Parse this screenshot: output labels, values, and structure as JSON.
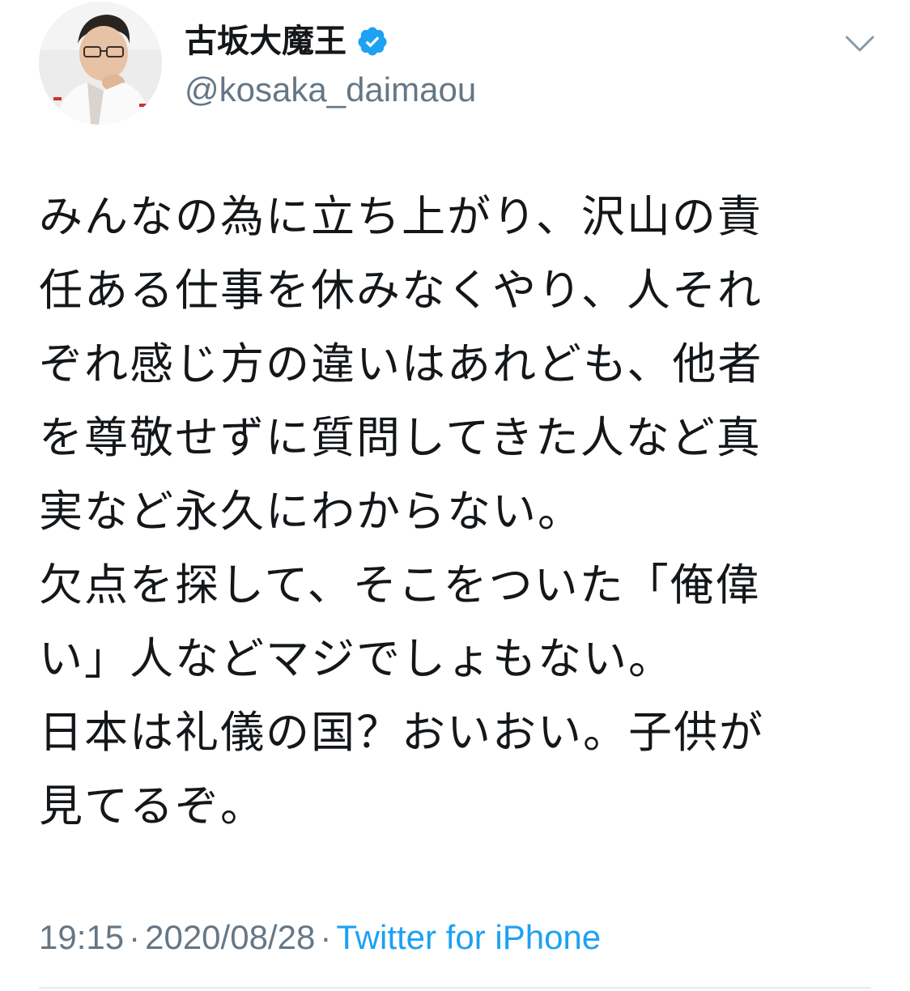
{
  "author": {
    "display_name": "古坂大魔王",
    "handle": "@kosaka_daimaou",
    "verified_icon": "verified-badge-icon",
    "avatar_icon": "profile-photo"
  },
  "menu_icon": "chevron-down-icon",
  "tweet": {
    "lines": [
      "みんなの為に立ち上がり、沢山の責",
      "任ある仕事を休みなくやり、人それ",
      "ぞれ感じ方の違いはあれども、他者",
      "を尊敬せずに質問してきた人など真",
      "実など永久にわからない。",
      "欠点を探して、そこをついた「俺偉",
      "い」人などマジでしょもない。",
      "日本は礼儀の国？おいおい。子供が",
      "見てるぞ。"
    ]
  },
  "meta": {
    "time": "19:15",
    "separator": "·",
    "date": "2020/08/28",
    "source": "Twitter for iPhone"
  },
  "colors": {
    "text": "#14171a",
    "secondary": "#657786",
    "accent": "#1da1f2",
    "divider": "#e6ecf0"
  }
}
